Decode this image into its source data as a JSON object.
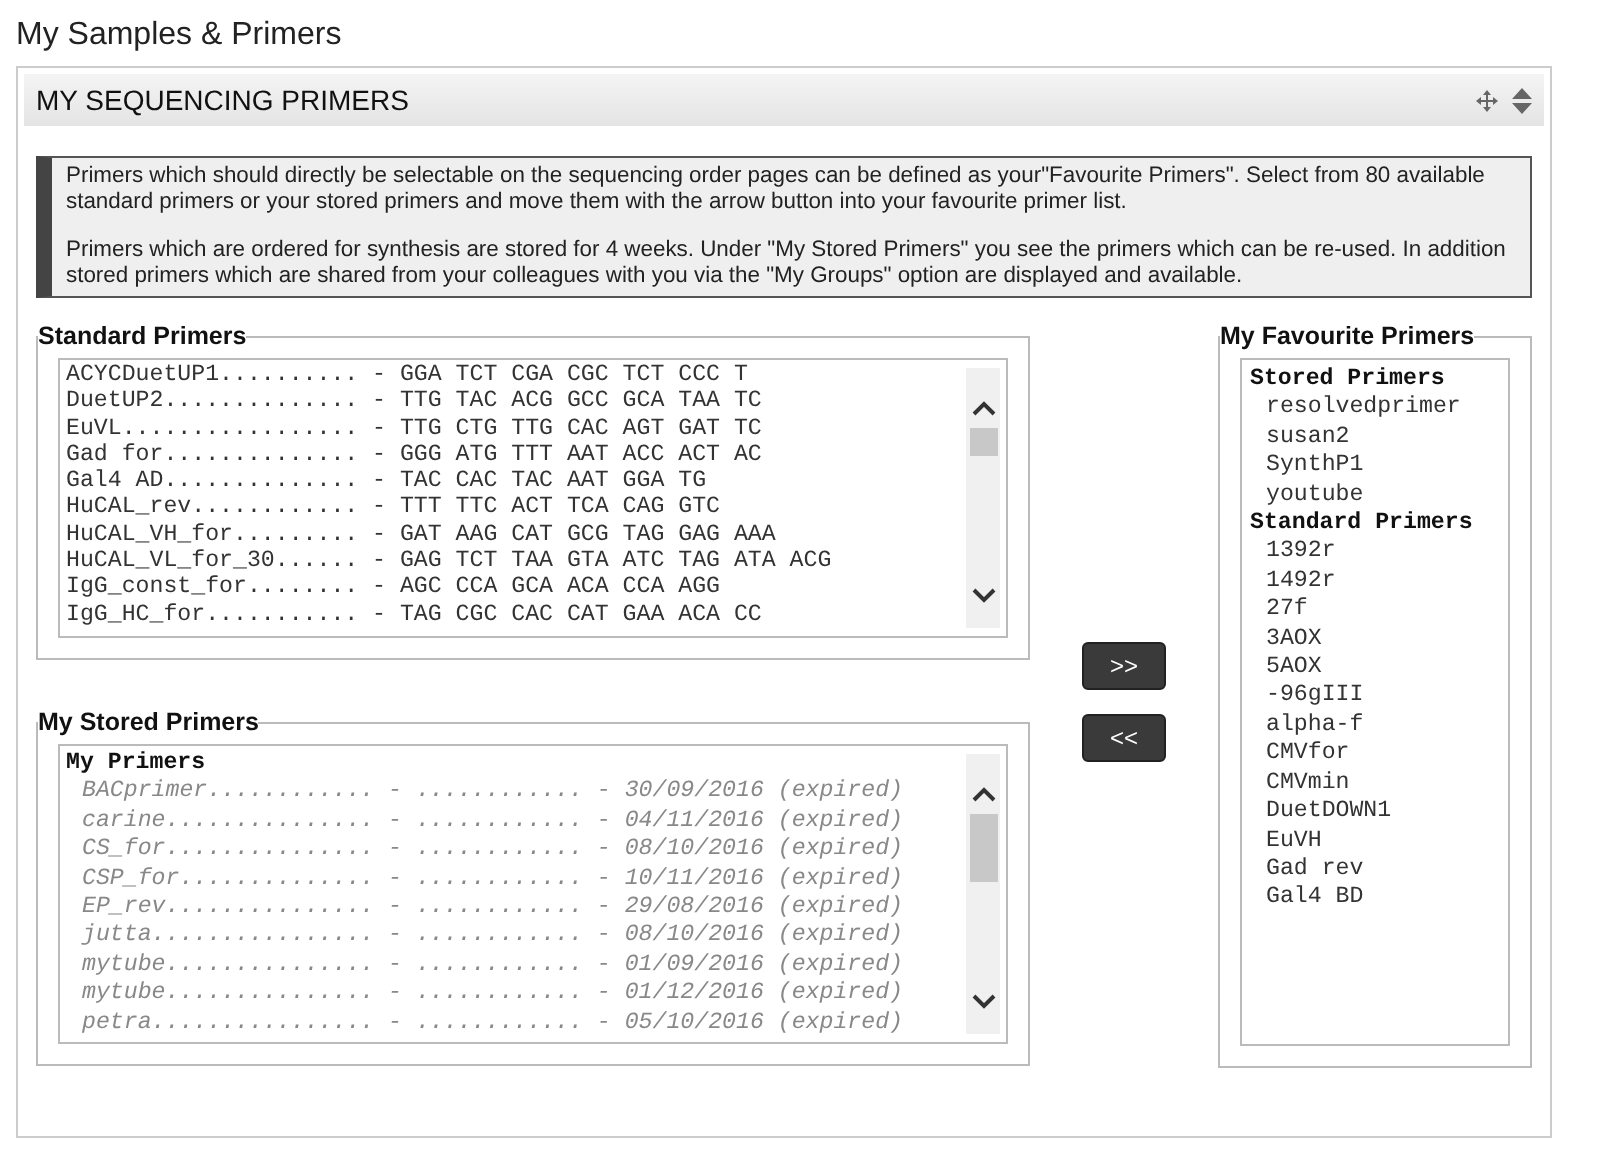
{
  "page_title": "My Samples & Primers",
  "panel": {
    "title": "MY SEQUENCING PRIMERS",
    "info": [
      "Primers which should directly be selectable on the sequencing order pages can be defined as your\"Favourite Primers\". Select from 80 available standard primers or your stored primers and move them with the arrow button into your favourite primer list.",
      "Primers which are ordered for synthesis are stored for 4 weeks. Under \"My Stored Primers\" you see the primers which can be re-used. In addition stored primers which are shared from your colleagues with you via the \"My Groups\" option are displayed and available."
    ]
  },
  "standard_primers": {
    "legend": "Standard Primers",
    "items": [
      "ACYCDuetUP1.......... - GGA TCT CGA CGC TCT CCC T",
      "DuetUP2.............. - TTG TAC ACG GCC GCA TAA TC",
      "EuVL................. - TTG CTG TTG CAC AGT GAT TC",
      "Gad for.............. - GGG ATG TTT AAT ACC ACT AC",
      "Gal4 AD.............. - TAC CAC TAC AAT GGA TG",
      "HuCAL_rev............ - TTT TTC ACT TCA CAG GTC",
      "HuCAL_VH_for......... - GAT AAG CAT GCG TAG GAG AAA",
      "HuCAL_VL_for_30...... - GAG TCT TAA GTA ATC TAG ATA ACG",
      "IgG_const_for........ - AGC CCA GCA ACA CCA AGG",
      "IgG_HC_for........... - TAG CGC CAC CAT GAA ACA CC"
    ]
  },
  "stored_primers": {
    "legend": "My Stored Primers",
    "group": "My Primers",
    "items": [
      {
        "text": "BACprimer............ - ............ - 30/09/2016 (expired)",
        "expired": true
      },
      {
        "text": "carine............... - ............ - 04/11/2016 (expired)",
        "expired": true
      },
      {
        "text": "CS_for............... - ............ - 08/10/2016 (expired)",
        "expired": true
      },
      {
        "text": "CSP_for.............. - ............ - 10/11/2016 (expired)",
        "expired": true
      },
      {
        "text": "EP_rev............... - ............ - 29/08/2016 (expired)",
        "expired": true
      },
      {
        "text": "jutta................ - ............ - 08/10/2016 (expired)",
        "expired": true
      },
      {
        "text": "mytube............... - ............ - 01/09/2016 (expired)",
        "expired": true
      },
      {
        "text": "mytube............... - ............ - 01/12/2016 (expired)",
        "expired": true
      },
      {
        "text": "petra................ - ............ - 05/10/2016 (expired)",
        "expired": true
      }
    ]
  },
  "buttons": [
    ">>",
    "<<"
  ],
  "favourite_primers": {
    "legend": "My Favourite Primers",
    "groups": [
      {
        "label": "Stored Primers",
        "items": [
          "resolvedprimer",
          "susan2",
          "SynthP1",
          "youtube"
        ]
      },
      {
        "label": "Standard Primers",
        "items": [
          "1392r",
          "1492r",
          "27f",
          "3AOX",
          "5AOX",
          "-96gIII",
          "alpha-f",
          "CMVfor",
          "CMVmin",
          "DuetDOWN1",
          "EuVH",
          "Gad rev",
          "Gal4 BD"
        ]
      }
    ]
  }
}
